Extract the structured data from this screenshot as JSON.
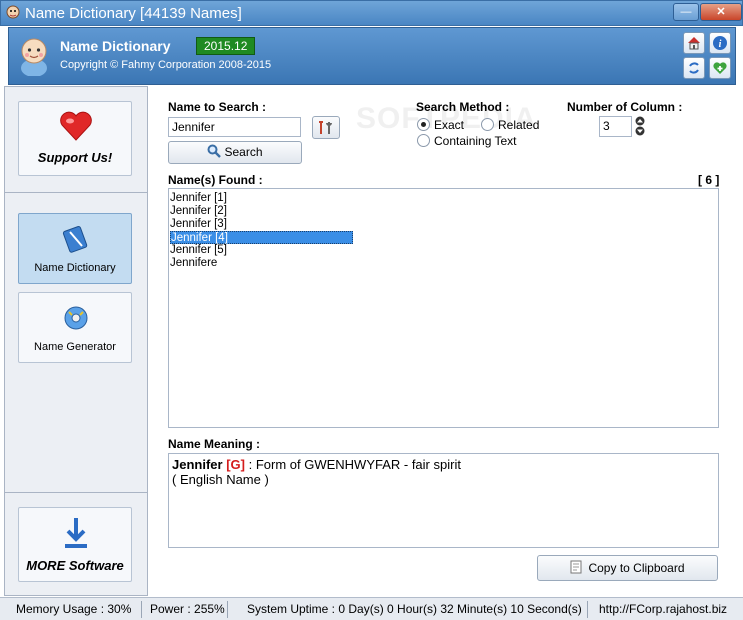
{
  "window": {
    "title": "Name Dictionary [44139 Names]",
    "minimize_glyph": "—",
    "close_glyph": "✕"
  },
  "header": {
    "app_name": "Name Dictionary",
    "version": "2015.12",
    "copyright": "Copyright © Fahmy Corporation 2008-2015",
    "icons": [
      "home-icon",
      "info-icon",
      "refresh-icon",
      "add-favorite-icon"
    ]
  },
  "sidebar": {
    "support": "Support Us!",
    "items": [
      {
        "label": "Name Dictionary",
        "icon": "book-icon",
        "active": true
      },
      {
        "label": "Name Generator",
        "icon": "generator-icon",
        "active": false
      }
    ],
    "more": "MORE Software"
  },
  "search": {
    "label": "Name to Search :",
    "value": "Jennifer",
    "button": "Search"
  },
  "method": {
    "label": "Search Method :",
    "options": [
      "Exact",
      "Related",
      "Containing Text"
    ],
    "selected": "Exact"
  },
  "columns": {
    "label": "Number of Column :",
    "value": "3"
  },
  "results": {
    "label": "Name(s) Found :",
    "count": "[ 6 ]",
    "items": [
      "Jennifer [1]",
      "Jennifer [2]",
      "Jennifer [3]",
      "Jennifer [4]",
      "Jennifer [5]",
      "Jennifere"
    ],
    "selected_index": 3
  },
  "meaning": {
    "label": "Name Meaning :",
    "name": "Jennifer",
    "gender": "[G]",
    "text": " : Form of GWENHWYFAR - fair spirit",
    "origin": "( English Name )"
  },
  "clipboard_button": "Copy to Clipboard",
  "status": {
    "memory": "Memory Usage : 30%",
    "power": "Power : 255%",
    "uptime": "System Uptime : 0 Day(s) 0 Hour(s) 32 Minute(s) 10 Second(s)",
    "url": "http://FCorp.rajahost.biz"
  },
  "watermark": "SOFTPEDIA",
  "colors": {
    "accent": "#3a76b4",
    "selection": "#3a8ee6",
    "version_badge": "#1f8a22",
    "gender_tag": "#d41c1c"
  }
}
